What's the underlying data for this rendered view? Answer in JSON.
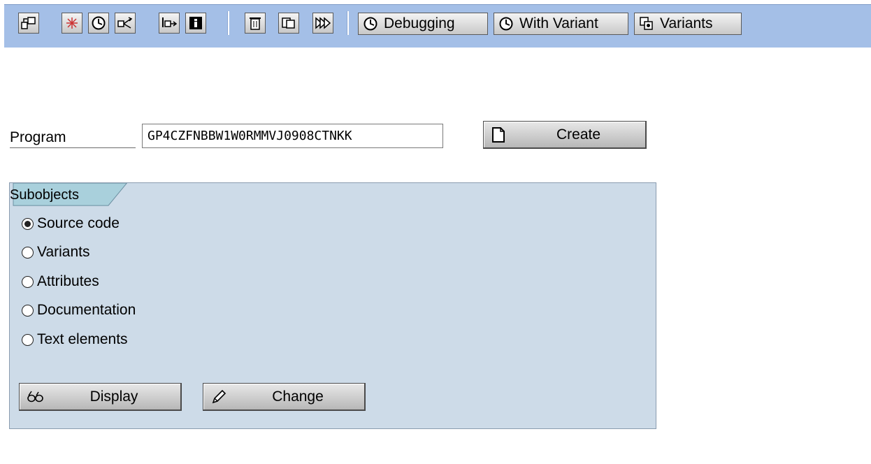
{
  "toolbar": {
    "icons": [
      {
        "name": "other-object-icon"
      },
      {
        "name": "check-syntax-icon"
      },
      {
        "name": "execute-icon"
      },
      {
        "name": "where-used-list-icon"
      },
      {
        "name": "activate-icon"
      },
      {
        "name": "info-icon"
      },
      {
        "name": "delete-icon"
      },
      {
        "name": "copy-icon"
      },
      {
        "name": "rename-icon"
      }
    ],
    "debugging_label": "Debugging",
    "with_variant_label": "With Variant",
    "variants_label": "Variants"
  },
  "program": {
    "label": "Program",
    "value": "GP4CZFNBBW1W0RMMVJ0908CTNKK"
  },
  "create_label": "Create",
  "subobjects": {
    "title": "Subobjects",
    "options": [
      {
        "label": "Source code",
        "selected": true
      },
      {
        "label": "Variants",
        "selected": false
      },
      {
        "label": "Attributes",
        "selected": false
      },
      {
        "label": "Documentation",
        "selected": false
      },
      {
        "label": "Text elements",
        "selected": false
      }
    ]
  },
  "display_label": "Display",
  "change_label": "Change"
}
